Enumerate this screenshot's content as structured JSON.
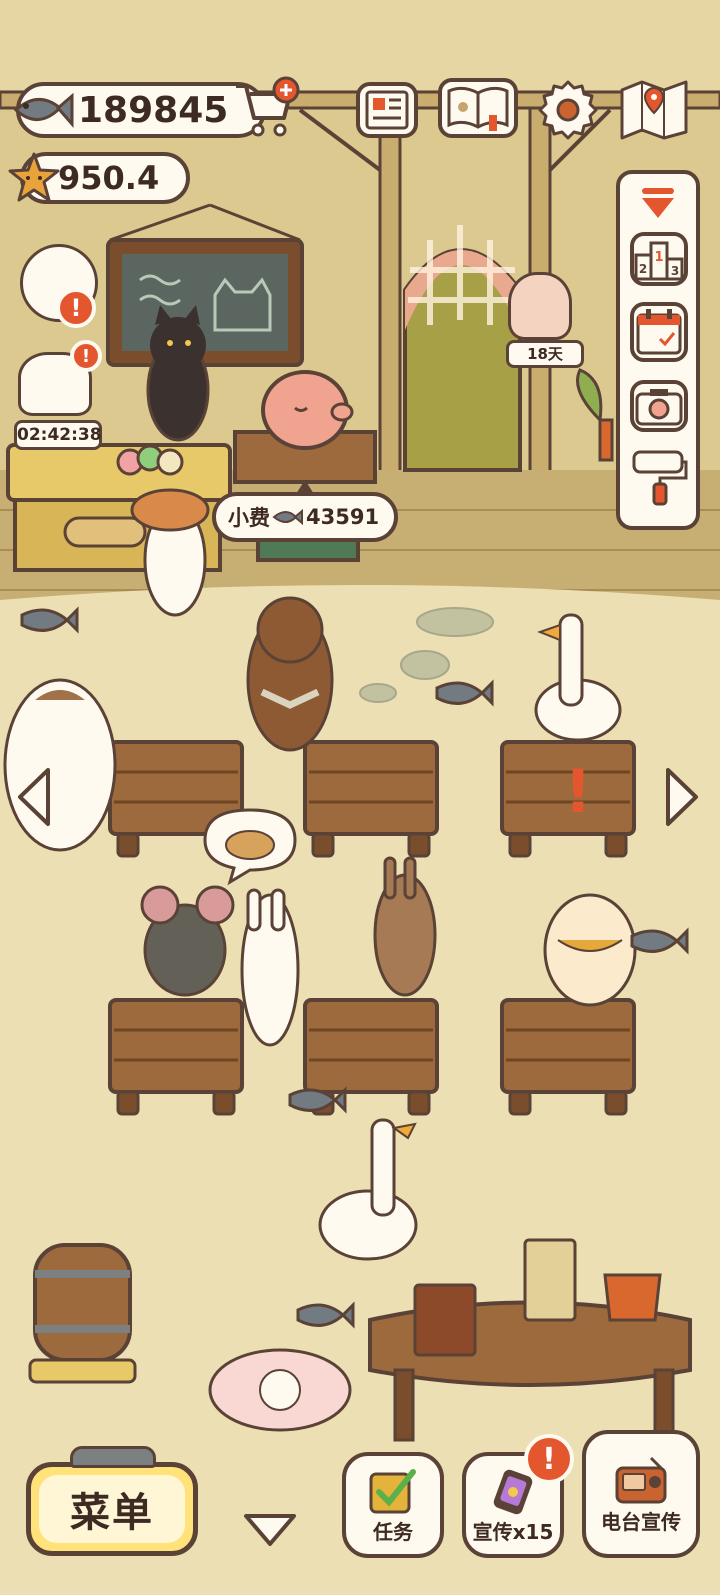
{
  "hud": {
    "fish_count": "189845",
    "star_count": "950.4"
  },
  "timer": {
    "value": "02:42:38"
  },
  "days_tag": {
    "label": "18天"
  },
  "tip_bubble": {
    "label": "小费",
    "amount": "43591"
  },
  "bottom_bar": {
    "menu_label": "菜单",
    "tasks_label": "任务",
    "promo_label": "宣传x15",
    "radio_label": "电台宣传"
  },
  "colors": {
    "wall": "#d9c58e",
    "floor": "#e9dcae",
    "outline": "#5b4236",
    "table_wood": "#9c6a3c",
    "alert": "#e4572e",
    "menu_button": "#ffe27a"
  },
  "icons": {
    "top": [
      "newspaper-icon",
      "recipe-book-icon",
      "gear-icon",
      "map-icon"
    ],
    "side": [
      "collapse-arrow-icon",
      "ranking-podium-icon",
      "calendar-icon",
      "camera-icon",
      "paint-roller-icon"
    ]
  }
}
